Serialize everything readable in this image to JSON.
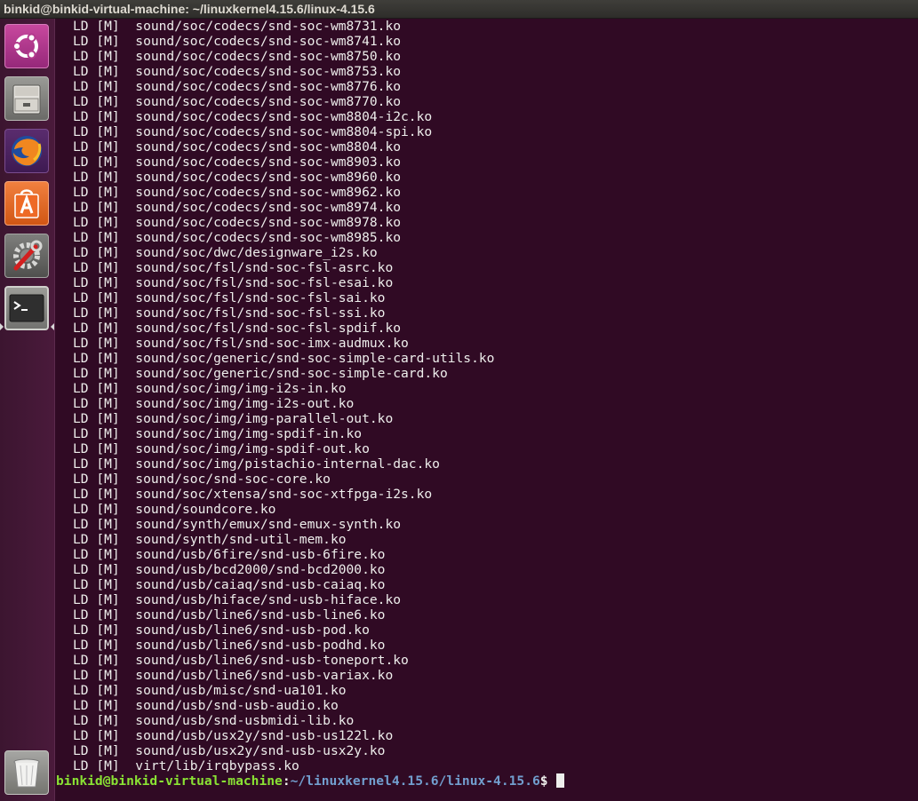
{
  "window": {
    "title": "binkid@binkid-virtual-machine: ~/linuxkernel4.15.6/linux-4.15.6"
  },
  "launcher": {
    "items": [
      {
        "name": "ubuntu-dash",
        "icon": "ubuntu-logo-icon"
      },
      {
        "name": "files",
        "icon": "file-cabinet-icon"
      },
      {
        "name": "firefox",
        "icon": "firefox-icon"
      },
      {
        "name": "software-center",
        "icon": "shopping-bag-icon"
      },
      {
        "name": "system-settings",
        "icon": "wrench-gear-icon"
      },
      {
        "name": "terminal",
        "icon": "terminal-icon",
        "active": true
      },
      {
        "name": "trash",
        "icon": "trash-icon"
      }
    ]
  },
  "terminal": {
    "lines": [
      "LD [M]  sound/soc/codecs/snd-soc-wm8731.ko",
      "LD [M]  sound/soc/codecs/snd-soc-wm8741.ko",
      "LD [M]  sound/soc/codecs/snd-soc-wm8750.ko",
      "LD [M]  sound/soc/codecs/snd-soc-wm8753.ko",
      "LD [M]  sound/soc/codecs/snd-soc-wm8776.ko",
      "LD [M]  sound/soc/codecs/snd-soc-wm8770.ko",
      "LD [M]  sound/soc/codecs/snd-soc-wm8804-i2c.ko",
      "LD [M]  sound/soc/codecs/snd-soc-wm8804-spi.ko",
      "LD [M]  sound/soc/codecs/snd-soc-wm8804.ko",
      "LD [M]  sound/soc/codecs/snd-soc-wm8903.ko",
      "LD [M]  sound/soc/codecs/snd-soc-wm8960.ko",
      "LD [M]  sound/soc/codecs/snd-soc-wm8962.ko",
      "LD [M]  sound/soc/codecs/snd-soc-wm8974.ko",
      "LD [M]  sound/soc/codecs/snd-soc-wm8978.ko",
      "LD [M]  sound/soc/codecs/snd-soc-wm8985.ko",
      "LD [M]  sound/soc/dwc/designware_i2s.ko",
      "LD [M]  sound/soc/fsl/snd-soc-fsl-asrc.ko",
      "LD [M]  sound/soc/fsl/snd-soc-fsl-esai.ko",
      "LD [M]  sound/soc/fsl/snd-soc-fsl-sai.ko",
      "LD [M]  sound/soc/fsl/snd-soc-fsl-ssi.ko",
      "LD [M]  sound/soc/fsl/snd-soc-fsl-spdif.ko",
      "LD [M]  sound/soc/fsl/snd-soc-imx-audmux.ko",
      "LD [M]  sound/soc/generic/snd-soc-simple-card-utils.ko",
      "LD [M]  sound/soc/generic/snd-soc-simple-card.ko",
      "LD [M]  sound/soc/img/img-i2s-in.ko",
      "LD [M]  sound/soc/img/img-i2s-out.ko",
      "LD [M]  sound/soc/img/img-parallel-out.ko",
      "LD [M]  sound/soc/img/img-spdif-in.ko",
      "LD [M]  sound/soc/img/img-spdif-out.ko",
      "LD [M]  sound/soc/img/pistachio-internal-dac.ko",
      "LD [M]  sound/soc/snd-soc-core.ko",
      "LD [M]  sound/soc/xtensa/snd-soc-xtfpga-i2s.ko",
      "LD [M]  sound/soundcore.ko",
      "LD [M]  sound/synth/emux/snd-emux-synth.ko",
      "LD [M]  sound/synth/snd-util-mem.ko",
      "LD [M]  sound/usb/6fire/snd-usb-6fire.ko",
      "LD [M]  sound/usb/bcd2000/snd-bcd2000.ko",
      "LD [M]  sound/usb/caiaq/snd-usb-caiaq.ko",
      "LD [M]  sound/usb/hiface/snd-usb-hiface.ko",
      "LD [M]  sound/usb/line6/snd-usb-line6.ko",
      "LD [M]  sound/usb/line6/snd-usb-pod.ko",
      "LD [M]  sound/usb/line6/snd-usb-podhd.ko",
      "LD [M]  sound/usb/line6/snd-usb-toneport.ko",
      "LD [M]  sound/usb/line6/snd-usb-variax.ko",
      "LD [M]  sound/usb/misc/snd-ua101.ko",
      "LD [M]  sound/usb/snd-usb-audio.ko",
      "LD [M]  sound/usb/snd-usbmidi-lib.ko",
      "LD [M]  sound/usb/usx2y/snd-usb-us122l.ko",
      "LD [M]  sound/usb/usx2y/snd-usb-usx2y.ko",
      "LD [M]  virt/lib/irqbypass.ko"
    ],
    "prompt": {
      "user_host": "binkid@binkid-virtual-machine",
      "separator": ":",
      "path": "~/linuxkernel4.15.6/linux-4.15.6",
      "symbol": "$"
    }
  },
  "colors": {
    "terminal_bg": "#300a24",
    "launcher_bg": "#4a1a3b",
    "prompt_user": "#8ae234",
    "prompt_path": "#729fcf",
    "text": "#eeeeec"
  }
}
